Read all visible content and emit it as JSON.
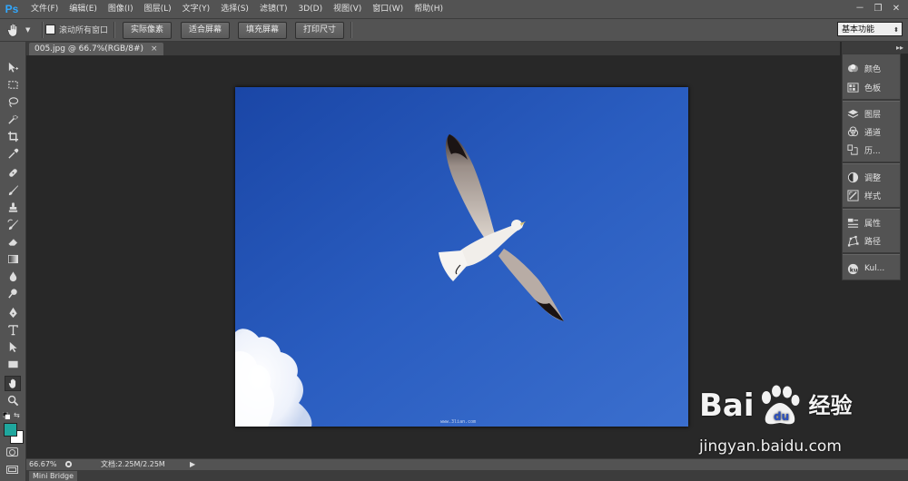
{
  "app": {
    "logo": "Ps"
  },
  "menu": [
    "文件(F)",
    "编辑(E)",
    "图像(I)",
    "图层(L)",
    "文字(Y)",
    "选择(S)",
    "滤镜(T)",
    "3D(D)",
    "视图(V)",
    "窗口(W)",
    "帮助(H)"
  ],
  "window_controls": [
    "－",
    "❐",
    "✕"
  ],
  "options": {
    "scroll_all_label": "滚动所有窗口",
    "buttons": [
      "实际像素",
      "适合屏幕",
      "填充屏幕",
      "打印尺寸"
    ],
    "workspace": "基本功能"
  },
  "document": {
    "tab_title": "005.jpg @ 66.7%(RGB/8#)",
    "close": "×",
    "image_caption": "www.3lian.com"
  },
  "toolbox": {
    "tools": [
      "move-icon",
      "marquee-icon",
      "lasso-icon",
      "quick-select-icon",
      "crop-icon",
      "eyedropper-icon",
      "healing-icon",
      "brush-icon",
      "stamp-icon",
      "history-brush-icon",
      "eraser-icon",
      "gradient-icon",
      "blur-icon",
      "dodge-icon",
      "pen-icon",
      "type-icon",
      "path-select-icon",
      "rectangle-icon",
      "hand-icon",
      "zoom-icon"
    ],
    "foreground_color": "#1fa79e",
    "background_color": "#ffffff"
  },
  "panels": {
    "collapse": "▸▸",
    "items": [
      {
        "label": "颜色",
        "icon": "color-icon"
      },
      {
        "label": "色板",
        "icon": "swatches-icon"
      },
      {
        "label": "图层",
        "icon": "layers-icon"
      },
      {
        "label": "通道",
        "icon": "channels-icon"
      },
      {
        "label": "历...",
        "icon": "history-icon"
      },
      {
        "label": "调整",
        "icon": "adjustments-icon"
      },
      {
        "label": "样式",
        "icon": "styles-icon"
      },
      {
        "label": "属性",
        "icon": "properties-icon"
      },
      {
        "label": "路径",
        "icon": "paths-icon"
      },
      {
        "label": "Kul...",
        "icon": "kuler-icon"
      }
    ]
  },
  "status": {
    "zoom": "66.67%",
    "doc_size": "文档:2.25M/2.25M",
    "arrow": "▶"
  },
  "bottom": {
    "mini_bridge": "Mini Bridge"
  },
  "watermark": {
    "brand": "Bai",
    "brand_cn": "经验",
    "url": "jingyan.baidu.com"
  }
}
